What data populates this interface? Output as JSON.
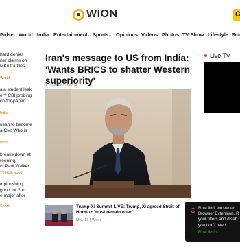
{
  "header": {
    "logo_text": "WION",
    "badge_text": "G"
  },
  "nav": {
    "items": [
      "Pulse",
      "World",
      "India",
      "Entertainment",
      "Sports",
      "Opinions",
      "Videos",
      "Photos",
      "TV Show",
      "Lifestyle",
      "Scie"
    ],
    "dropdown_indicator": "⌄"
  },
  "left_column": {
    "items": [
      {
        "lines": [
          "hard denies",
          "ner claims on",
          "MKultra files"
        ],
        "category": "World"
      },
      {
        "lines": [
          "ala student leak",
          "er? CBI probing",
          "ch-for-paper"
        ],
        "category": "India"
      },
      {
        "lines": [
          "usan to become",
          "a CM: Who is"
        ],
        "category": "India"
      },
      {
        "lines": [
          "breaks down at",
          "reening,",
          "rs Paul Walker"
        ],
        "category": "T | Hollywood"
      },
      {
        "lines": [
          "mpionship |",
          "good for 2nd",
          "e major after"
        ],
        "category": "Sports"
      }
    ]
  },
  "main": {
    "title": "Iran's message to US from India: 'Wants BRICS to shatter Western superiority'",
    "time_ago": "1 hour ago",
    "separator": "|",
    "category": "World"
  },
  "secondary": {
    "title": "Trump-Xi Summit LIVE: Trump, Xi agreed Strait of Hormuz 'must remain open'",
    "date": "May 13",
    "separator": "|",
    "category": "World"
  },
  "live_tv": {
    "label": "Live TV"
  },
  "toast": {
    "message": "Rule limit exceeded Browser Extension. R your filters and disab you don't need",
    "link": "Rule limits"
  },
  "colors": {
    "accent_orange": "#e07c1a",
    "live_red": "#e0312b",
    "toast_bg": "#121212",
    "toast_link": "#4caf50",
    "logo_yellow": "#f0b323"
  }
}
